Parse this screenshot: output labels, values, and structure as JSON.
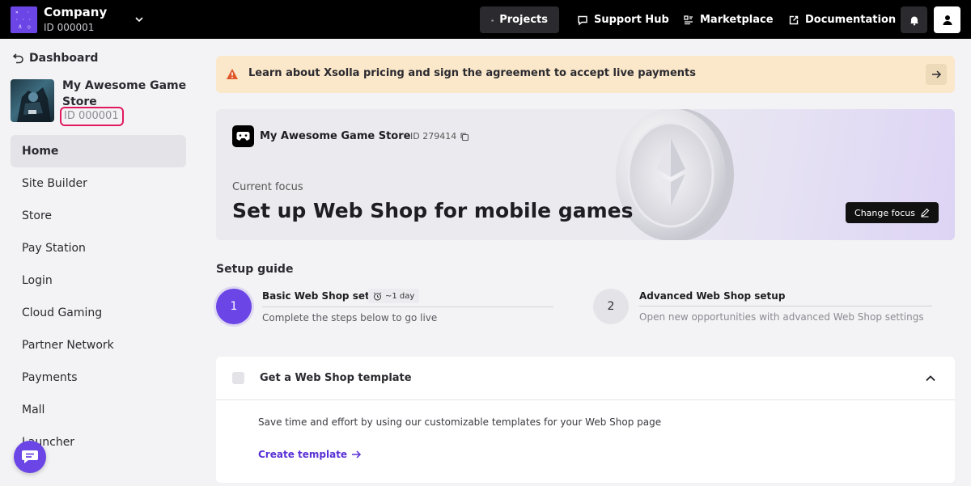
{
  "topbar": {
    "company_name": "Company",
    "company_id": "ID 000001",
    "nav": {
      "projects": "Projects",
      "support": "Support Hub",
      "marketplace": "Marketplace",
      "documentation": "Documentation"
    }
  },
  "sidebar": {
    "dashboard_label": "Dashboard",
    "game_name": "My Awesome Game Store",
    "game_id": "ID 000001",
    "items": [
      {
        "label": "Home",
        "active": true
      },
      {
        "label": "Site Builder"
      },
      {
        "label": "Store"
      },
      {
        "label": "Pay Station"
      },
      {
        "label": "Login"
      },
      {
        "label": "Cloud Gaming"
      },
      {
        "label": "Partner Network"
      },
      {
        "label": "Payments"
      },
      {
        "label": "Mall"
      },
      {
        "label": "Launcher"
      }
    ]
  },
  "banner": {
    "text": "Learn about Xsolla pricing and sign the agreement to accept live payments"
  },
  "hero": {
    "store_name": "My Awesome Game Store",
    "store_id": "ID 279414",
    "focus_label": "Current focus",
    "focus_title": "Set up Web Shop for mobile games",
    "change_focus_label": "Change focus"
  },
  "setup_guide": {
    "title": "Setup guide",
    "steps": [
      {
        "number": "1",
        "title": "Basic Web Shop setup",
        "duration": "~1 day",
        "description": "Complete the steps below to go live"
      },
      {
        "number": "2",
        "title": "Advanced Web Shop setup",
        "description": "Open new opportunities with advanced Web Shop settings"
      }
    ]
  },
  "task_card": {
    "title": "Get a Web Shop template",
    "description": "Save time and effort by using our customizable templates for your Web Shop page",
    "link_label": "Create template"
  },
  "colors": {
    "accent": "#6b45e6",
    "banner_bg": "#fbe7c9",
    "highlight_border": "#e0195f"
  }
}
